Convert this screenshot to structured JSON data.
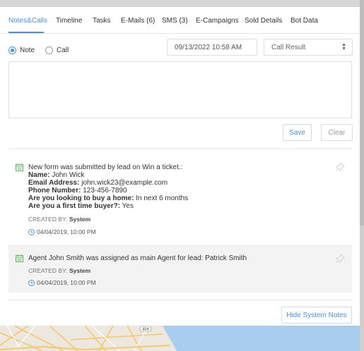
{
  "tabs": [
    {
      "label": "Notes&Calls",
      "active": true
    },
    {
      "label": "Timeline"
    },
    {
      "label": "Tasks"
    },
    {
      "label": "E-Mails (6)"
    },
    {
      "label": "SMS (3)"
    },
    {
      "label": "E-Campaigns"
    },
    {
      "label": "Sold Details"
    },
    {
      "label": "Bot Data"
    }
  ],
  "form": {
    "note_label": "Note",
    "call_label": "Call",
    "selected": "Note",
    "datetime": "09/13/2022 10:58 AM",
    "call_result_placeholder": "Call Result",
    "save_label": "Save",
    "clear_label": "Clear"
  },
  "notes": [
    {
      "line1": "New form was submitted by lead on Win a ticket.:",
      "fields": [
        {
          "label": "Name:",
          "value": "John Wick"
        },
        {
          "label": "Email Address:",
          "value": "john.wick23@example.com"
        },
        {
          "label": "Phone Number:",
          "value": "123-456-7890"
        },
        {
          "label": "Are you looking to buy a home:",
          "value": "In next 6 months"
        },
        {
          "label": "Are you a first time buyer?:",
          "value": "Yes"
        }
      ],
      "created_by_label": "CREATED BY:",
      "created_by": "System",
      "date": "04/04/2019, 10:00 PM"
    },
    {
      "line1": "Agent John Smith was assigned as main Agent for lead: Patrick Smith",
      "created_by_label": "CREATED BY:",
      "created_by": "System",
      "date": "04/04/2019, 10:00 PM"
    }
  ],
  "hide_system_notes_label": "Hide System Notes",
  "map_label": "404",
  "colors": {
    "accent": "#4a90e2",
    "note_icon": "#5cb85c"
  }
}
